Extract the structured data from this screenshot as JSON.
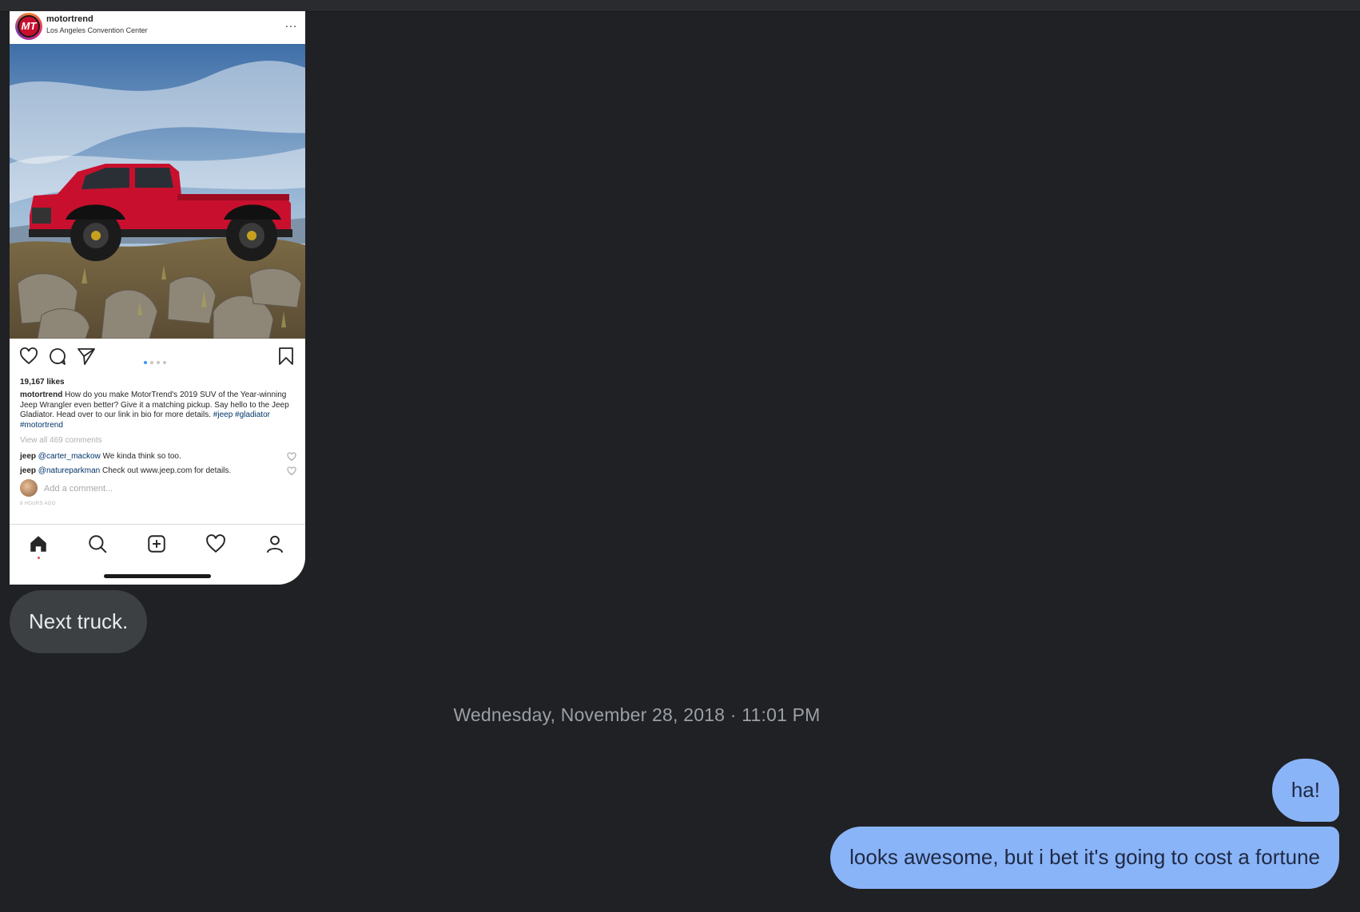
{
  "conversation": {
    "messages": [
      {
        "direction": "incoming",
        "type": "image"
      },
      {
        "direction": "incoming",
        "text": "Next truck."
      },
      {
        "direction": "outgoing",
        "text": "ha!"
      },
      {
        "direction": "outgoing",
        "text": "looks awesome, but i bet it's going to cost a fortune"
      }
    ],
    "timestamp": "Wednesday, November 28, 2018 · 11:01 PM"
  },
  "screenshot": {
    "account": {
      "username": "motortrend",
      "avatar_initials": "MT",
      "location": "Los Angeles Convention Center"
    },
    "more_icon": "…",
    "likes": "19,167 likes",
    "caption": {
      "user": "motortrend",
      "text": "How do you make MotorTrend's 2019 SUV of the Year-winning Jeep Wrangler even better? Give it a matching pickup. Say hello to the Jeep Gladiator. Head over to our link in bio for more details.",
      "tags": "#jeep #gladiator #motortrend"
    },
    "view_all": "View all 469 comments",
    "comments": [
      {
        "user": "jeep",
        "mention": "@carter_mackow",
        "text": "We kinda think so too."
      },
      {
        "user": "jeep",
        "mention": "@natureparkman",
        "text": "Check out www.jeep.com for details."
      }
    ],
    "add_comment_placeholder": "Add a comment...",
    "time_ago": "8 HOURS AGO",
    "carousel": {
      "count": 4,
      "active": 1
    },
    "icons": [
      "heart-icon",
      "comment-icon",
      "share-icon",
      "bookmark-icon",
      "home-icon",
      "search-icon",
      "add-post-icon",
      "activity-heart-icon",
      "profile-icon"
    ],
    "colors": {
      "truck": "#c8102e",
      "link": "#003569",
      "carousel_active": "#3897f0"
    }
  },
  "colors": {
    "background": "#202124",
    "incoming_bubble": "#3c4043",
    "outgoing_bubble": "#8ab4f8",
    "timestamp": "#9aa0a6"
  }
}
